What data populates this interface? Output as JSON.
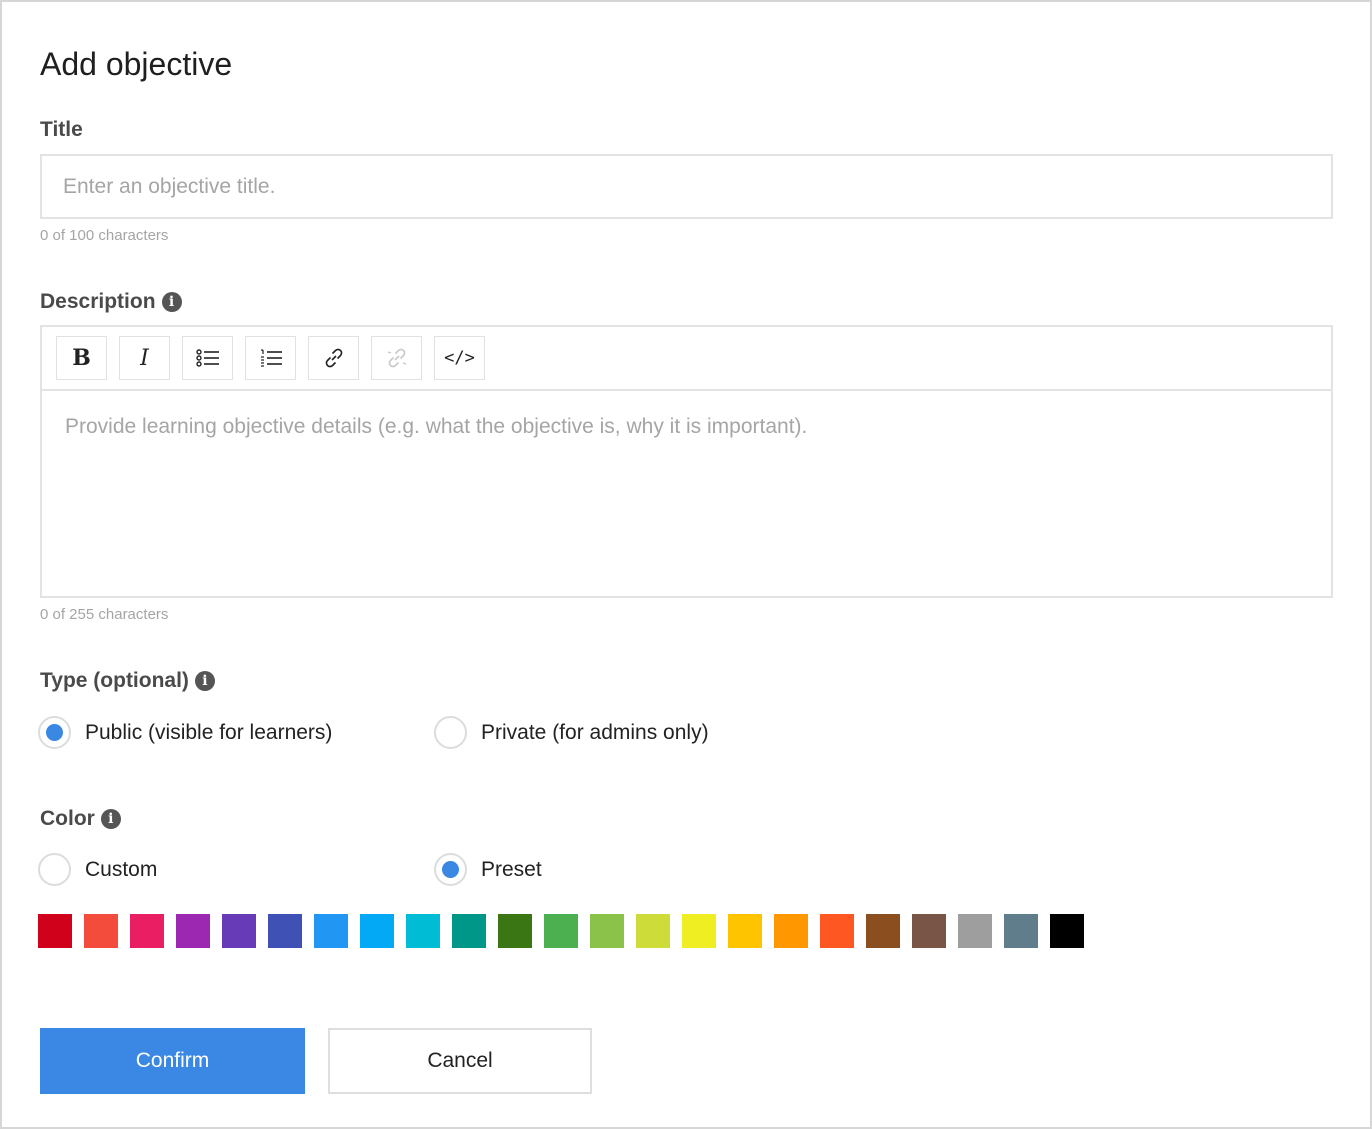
{
  "dialog": {
    "title": "Add objective"
  },
  "title_field": {
    "label": "Title",
    "value": "",
    "placeholder": "Enter an objective title.",
    "counter": "0 of 100 characters"
  },
  "description_field": {
    "label": "Description",
    "info_icon": "info-icon",
    "toolbar": {
      "bold": "B",
      "italic": "I",
      "bullet_list_icon": "bulleted-list-icon",
      "numbered_list_icon": "numbered-list-icon",
      "link_icon": "link-icon",
      "unlink_icon": "unlink-icon",
      "code": "</>"
    },
    "placeholder": "Provide learning objective details (e.g. what the objective is, why it is important).",
    "counter": "0 of 255 characters"
  },
  "type_field": {
    "label": "Type (optional)",
    "options": [
      {
        "label": "Public (visible for learners)",
        "checked": true
      },
      {
        "label": "Private (for admins only)",
        "checked": false
      }
    ]
  },
  "color_field": {
    "label": "Color",
    "options": [
      {
        "label": "Custom",
        "checked": false
      },
      {
        "label": "Preset",
        "checked": true
      }
    ],
    "presets": [
      "#d0021b",
      "#f44c3c",
      "#e91e63",
      "#9c27b0",
      "#673ab7",
      "#3f51b5",
      "#2196f3",
      "#03a9f4",
      "#00bcd4",
      "#009688",
      "#3a7613",
      "#4caf50",
      "#8bc34a",
      "#cddc39",
      "#eeee22",
      "#ffc400",
      "#ff9800",
      "#ff5722",
      "#8b4f1f",
      "#795548",
      "#9e9e9e",
      "#607d8b",
      "#000000"
    ]
  },
  "accent_color": "#3a87e4",
  "actions": {
    "confirm": "Confirm",
    "cancel": "Cancel"
  }
}
